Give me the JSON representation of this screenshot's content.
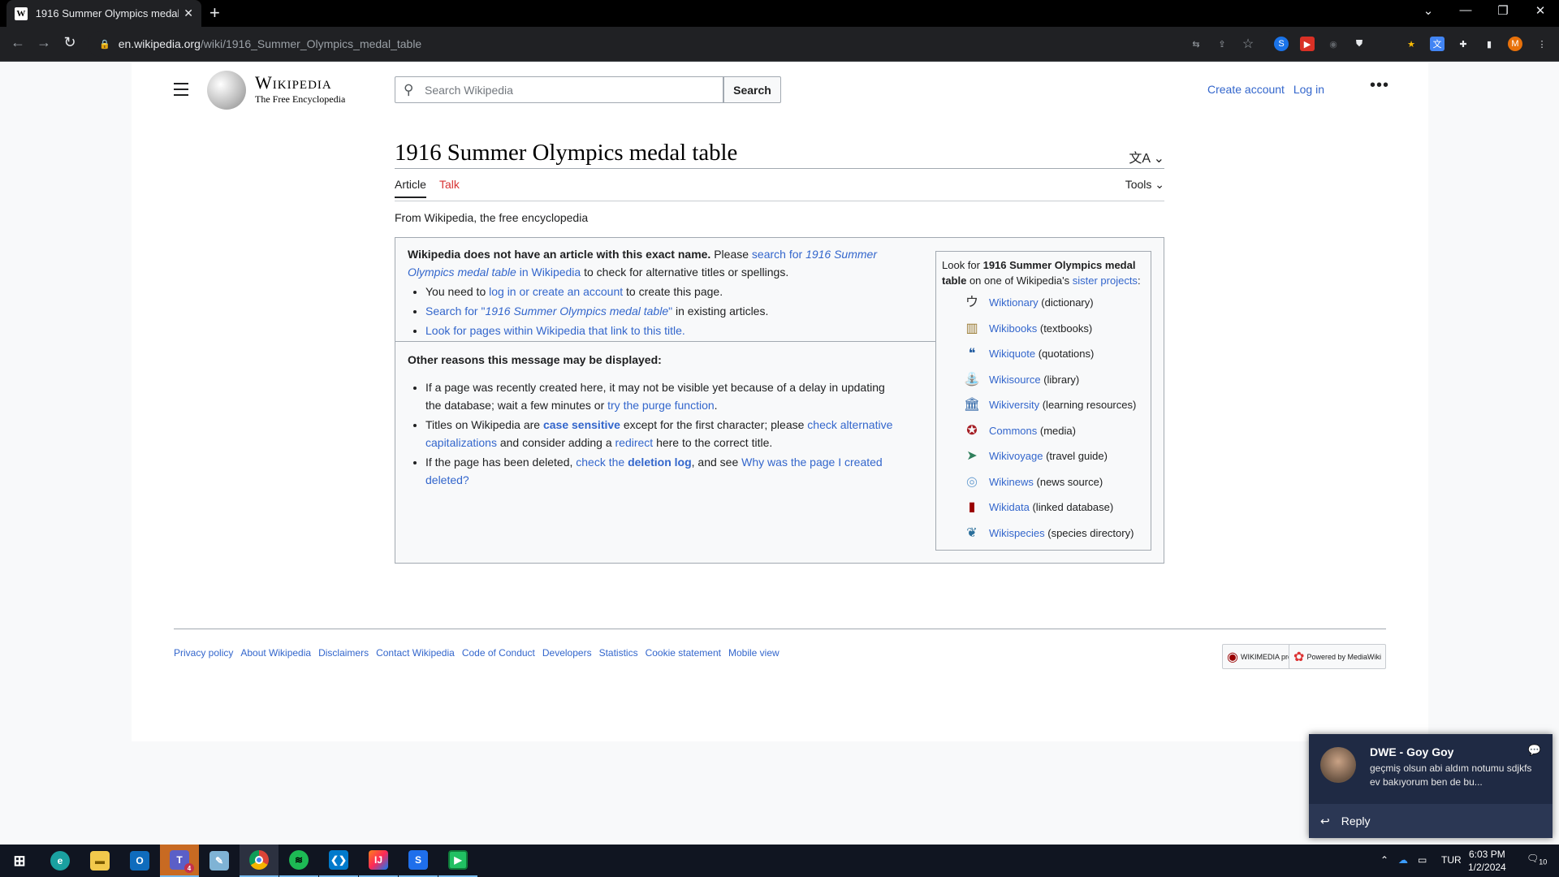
{
  "browser": {
    "tab_title": "1916 Summer Olympics medal t",
    "url_domain": "en.wikipedia.org",
    "url_path": "/wiki/1916_Summer_Olympics_medal_table",
    "profile_initial": "M"
  },
  "header": {
    "wordmark": "Wikipedia",
    "tagline": "The Free Encyclopedia",
    "search_placeholder": "Search Wikipedia",
    "search_button": "Search",
    "create_account": "Create account",
    "log_in": "Log in",
    "more": "•••"
  },
  "article": {
    "title": "1916 Summer Olympics medal table",
    "lang_icon": "文A",
    "tab_article": "Article",
    "tab_talk": "Talk",
    "tools": "Tools",
    "from": "From Wikipedia, the free encyclopedia"
  },
  "notice": {
    "lead_bold": "Wikipedia does not have an article with this exact name.",
    "lead_please": " Please ",
    "lead_link1": "search for ",
    "lead_link_italic": "1916 Summer Olympics medal table",
    "lead_link2": " in Wikipedia",
    "lead_rest": " to check for alternative titles or spellings.",
    "b1_pre": "You need to ",
    "b1_link": "log in or create an account",
    "b1_post": " to create this page.",
    "b2_link_pre": "Search for \"",
    "b2_link_italic": "1916 Summer Olympics medal table",
    "b2_link_post": "\"",
    "b2_post": " in existing articles.",
    "b3_link": "Look for pages within Wikipedia that link to this title.",
    "other_heading": "Other reasons this message may be displayed:",
    "o1_pre": "If a page was recently created here, it may not be visible yet because of a delay in updating the database; wait a few minutes or ",
    "o1_link": "try the purge function",
    "o1_post": ".",
    "o2_pre": "Titles on Wikipedia are ",
    "o2_bold_link": "case sensitive",
    "o2_mid": " except for the first character; please ",
    "o2_link": "check alternative capitalizations",
    "o2_mid2": " and consider adding a ",
    "o2_link2": "redirect",
    "o2_post": " here to the correct title.",
    "o3_pre": "If the page has been deleted, ",
    "o3_link_a": "check the ",
    "o3_link_bold": "deletion log",
    "o3_mid": ", and see ",
    "o3_link2": "Why was the page I created deleted?"
  },
  "sister": {
    "intro_pre": "Look for ",
    "intro_bold": "1916 Summer Olympics medal table",
    "intro_mid": " on one of Wikipedia's ",
    "intro_link": "sister projects",
    "intro_post": ":",
    "projects": [
      {
        "name": "Wiktionary",
        "desc": " (dictionary)",
        "icon": "wiktionary-icon",
        "glyph": "ウ",
        "color": "#333333"
      },
      {
        "name": "Wikibooks",
        "desc": " (textbooks)",
        "icon": "wikibooks-icon",
        "glyph": "▥",
        "color": "#9a7b33"
      },
      {
        "name": "Wikiquote",
        "desc": " (quotations)",
        "icon": "wikiquote-icon",
        "glyph": "❝",
        "color": "#1f5aa0"
      },
      {
        "name": "Wikisource",
        "desc": " (library)",
        "icon": "wikisource-icon",
        "glyph": "⛲",
        "color": "#1f5aa0"
      },
      {
        "name": "Wikiversity",
        "desc": " (learning resources)",
        "icon": "wikiversity-icon",
        "glyph": "🏛",
        "color": "#1f5aa0"
      },
      {
        "name": "Commons",
        "desc": " (media)",
        "icon": "commons-icon",
        "glyph": "✪",
        "color": "#a51e24"
      },
      {
        "name": "Wikivoyage",
        "desc": " (travel guide)",
        "icon": "wikivoyage-icon",
        "glyph": "➤",
        "color": "#2f7f5b"
      },
      {
        "name": "Wikinews",
        "desc": " (news source)",
        "icon": "wikinews-icon",
        "glyph": "◎",
        "color": "#6ea1d2"
      },
      {
        "name": "Wikidata",
        "desc": " (linked database)",
        "icon": "wikidata-icon",
        "glyph": "▮",
        "color": "#990000"
      },
      {
        "name": "Wikispecies",
        "desc": " (species directory)",
        "icon": "wikispecies-icon",
        "glyph": "❦",
        "color": "#2a6f9b"
      }
    ]
  },
  "footer": {
    "links": [
      "Privacy policy",
      "About Wikipedia",
      "Disclaimers",
      "Contact Wikipedia",
      "Code of Conduct",
      "Developers",
      "Statistics",
      "Cookie statement",
      "Mobile view"
    ],
    "badge1": "WIKIMEDIA project",
    "badge2": "Powered by MediaWiki"
  },
  "notification": {
    "sender": "DWE - Goy Goy",
    "message": "geçmiş olsun abi aldım notumu sdjkfs ev bakıyorum ben de bu...",
    "reply": "Reply"
  },
  "taskbar": {
    "language": "TUR",
    "time": "6:03 PM",
    "date": "1/2/2024",
    "notif_count": "10",
    "teams_badge": "4"
  }
}
